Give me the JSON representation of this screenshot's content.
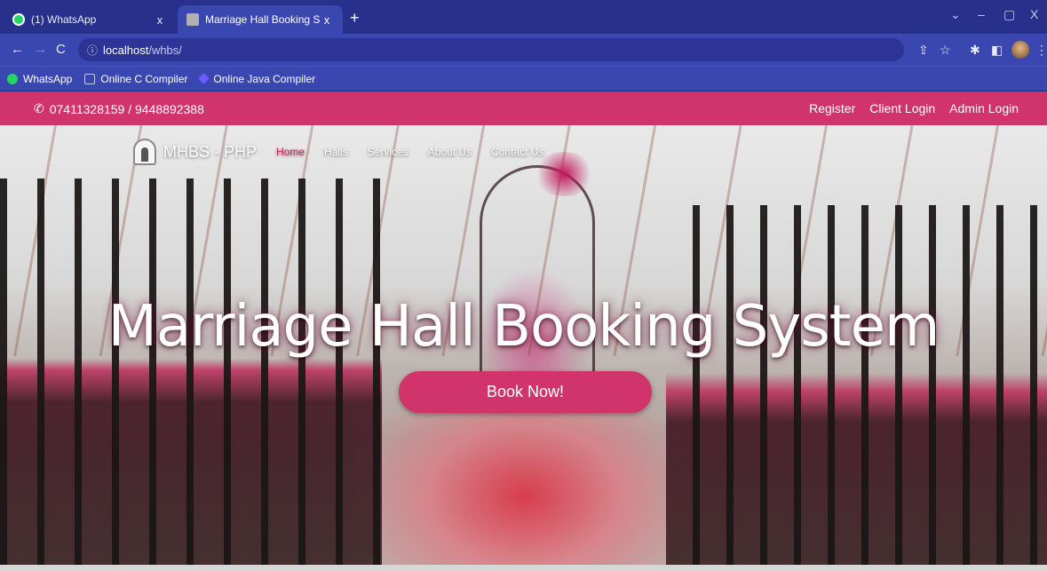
{
  "browser": {
    "tabs": [
      {
        "title": "(1) WhatsApp",
        "close": "x"
      },
      {
        "title": "Marriage Hall Booking System",
        "close": "x"
      }
    ],
    "new_tab": "+",
    "window_controls": {
      "minimize": "–",
      "restore": "▢",
      "close": "X"
    },
    "chevron": "⌄",
    "url_host": "localhost",
    "url_path": "/whbs/",
    "bookmarks": [
      "WhatsApp",
      "Online C Compiler",
      "Online Java Compiler"
    ]
  },
  "site": {
    "phone": "07411328159 / 9448892388",
    "top_links": [
      "Register",
      "Client Login",
      "Admin Login"
    ],
    "brand": "MHBS - PHP",
    "nav": [
      "Home",
      "Halls",
      "Services",
      "About Us",
      "Contact Us"
    ],
    "active_nav": "Home",
    "hero_title": "Marriage Hall Booking System",
    "cta": "Book Now!",
    "accent_color": "#d1336b"
  }
}
